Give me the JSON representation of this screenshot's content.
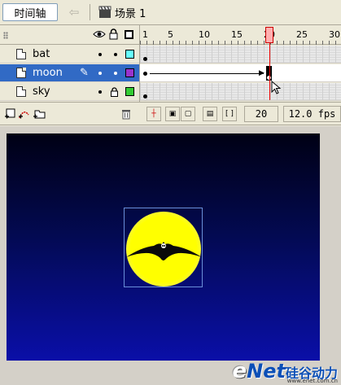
{
  "toolbar": {
    "timeline_button": "时间轴",
    "scene_label": "场景 1"
  },
  "timeline": {
    "ruler_labels": [
      "1",
      "5",
      "10",
      "15",
      "20",
      "25",
      "30"
    ],
    "current_frame_marker": 20,
    "layers": [
      {
        "name": "bat",
        "color": "#66ffff",
        "locked": false,
        "selected": false
      },
      {
        "name": "moon",
        "color": "#9933cc",
        "locked": false,
        "selected": true
      },
      {
        "name": "sky",
        "color": "#33cc33",
        "locked": true,
        "selected": false
      }
    ]
  },
  "controls": {
    "current_frame": "20",
    "frame_rate": "12.0 fps"
  },
  "stage": {
    "background_top": "#000014",
    "background_bottom": "#0a0fa8",
    "moon_color": "#ffff00"
  },
  "watermark": {
    "e": "e",
    "net": "Net",
    "cn": "硅谷动力",
    "url": "www.enet.com.cn"
  }
}
